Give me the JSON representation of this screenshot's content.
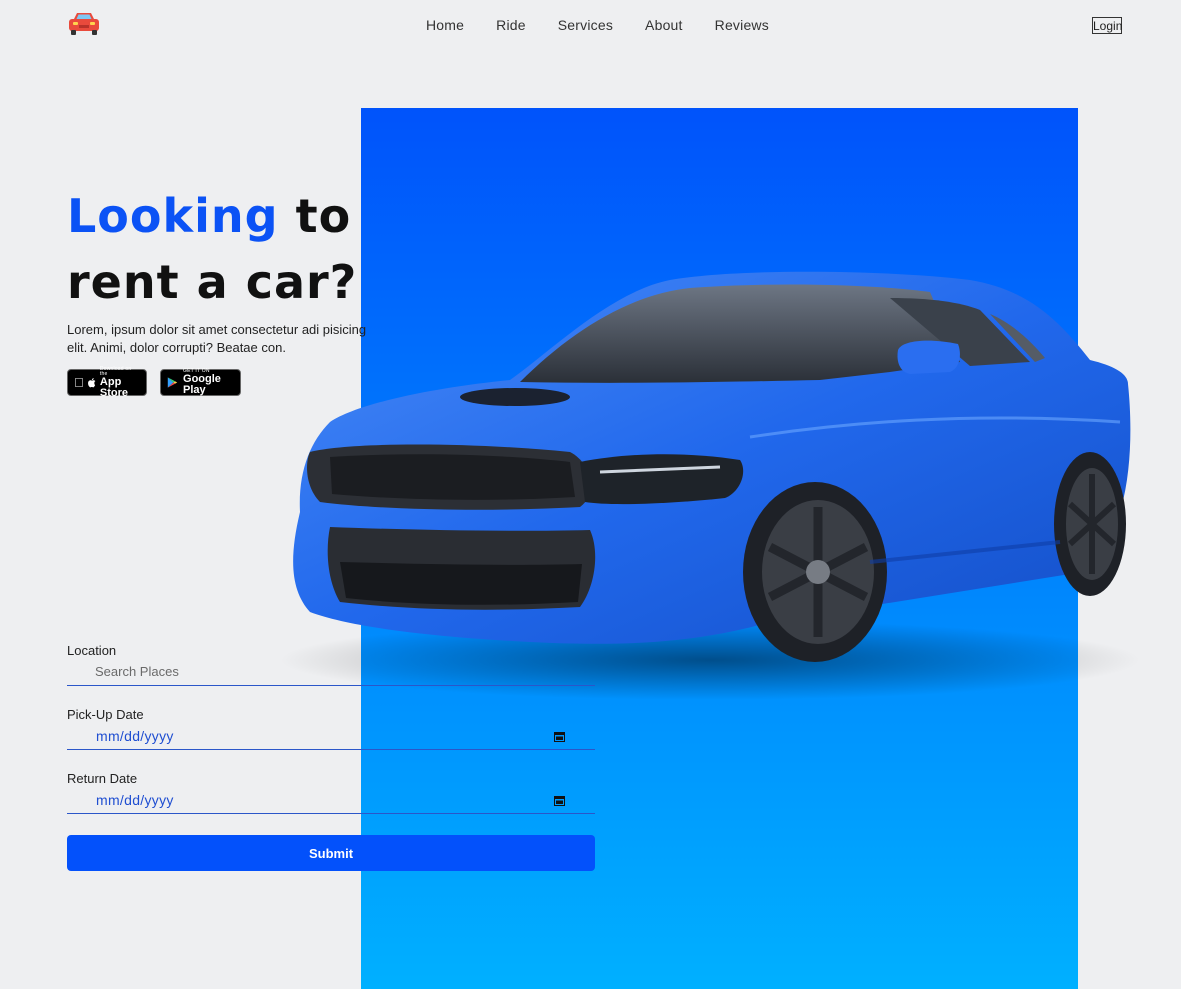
{
  "header": {
    "logo_icon": "car-icon",
    "nav": [
      "Home",
      "Ride",
      "Services",
      "About",
      "Reviews"
    ],
    "login_label": "Login"
  },
  "hero": {
    "title_accent": "Looking",
    "title_rest_1": "to",
    "title_rest_2": "rent a car?",
    "description": "Lorem, ipsum dolor sit amet consectetur adi pisicing elit. Animi, dolor corrupti? Beatae con.",
    "appstore_small": "Download on the",
    "appstore_big": "App Store",
    "gplay_small": "GET IT ON",
    "gplay_big": "Google Play"
  },
  "form": {
    "location_label": "Location",
    "location_placeholder": "Search Places",
    "pickup_label": "Pick-Up Date",
    "pickup_value": "mm/dd/yyyy",
    "return_label": "Return Date",
    "return_value": "mm/dd/yyyy",
    "submit_label": "Submit"
  },
  "colors": {
    "accent": "#0b52f5",
    "panel_top": "#0053fb",
    "panel_bottom": "#00b0ff",
    "submit": "#0351fb"
  }
}
